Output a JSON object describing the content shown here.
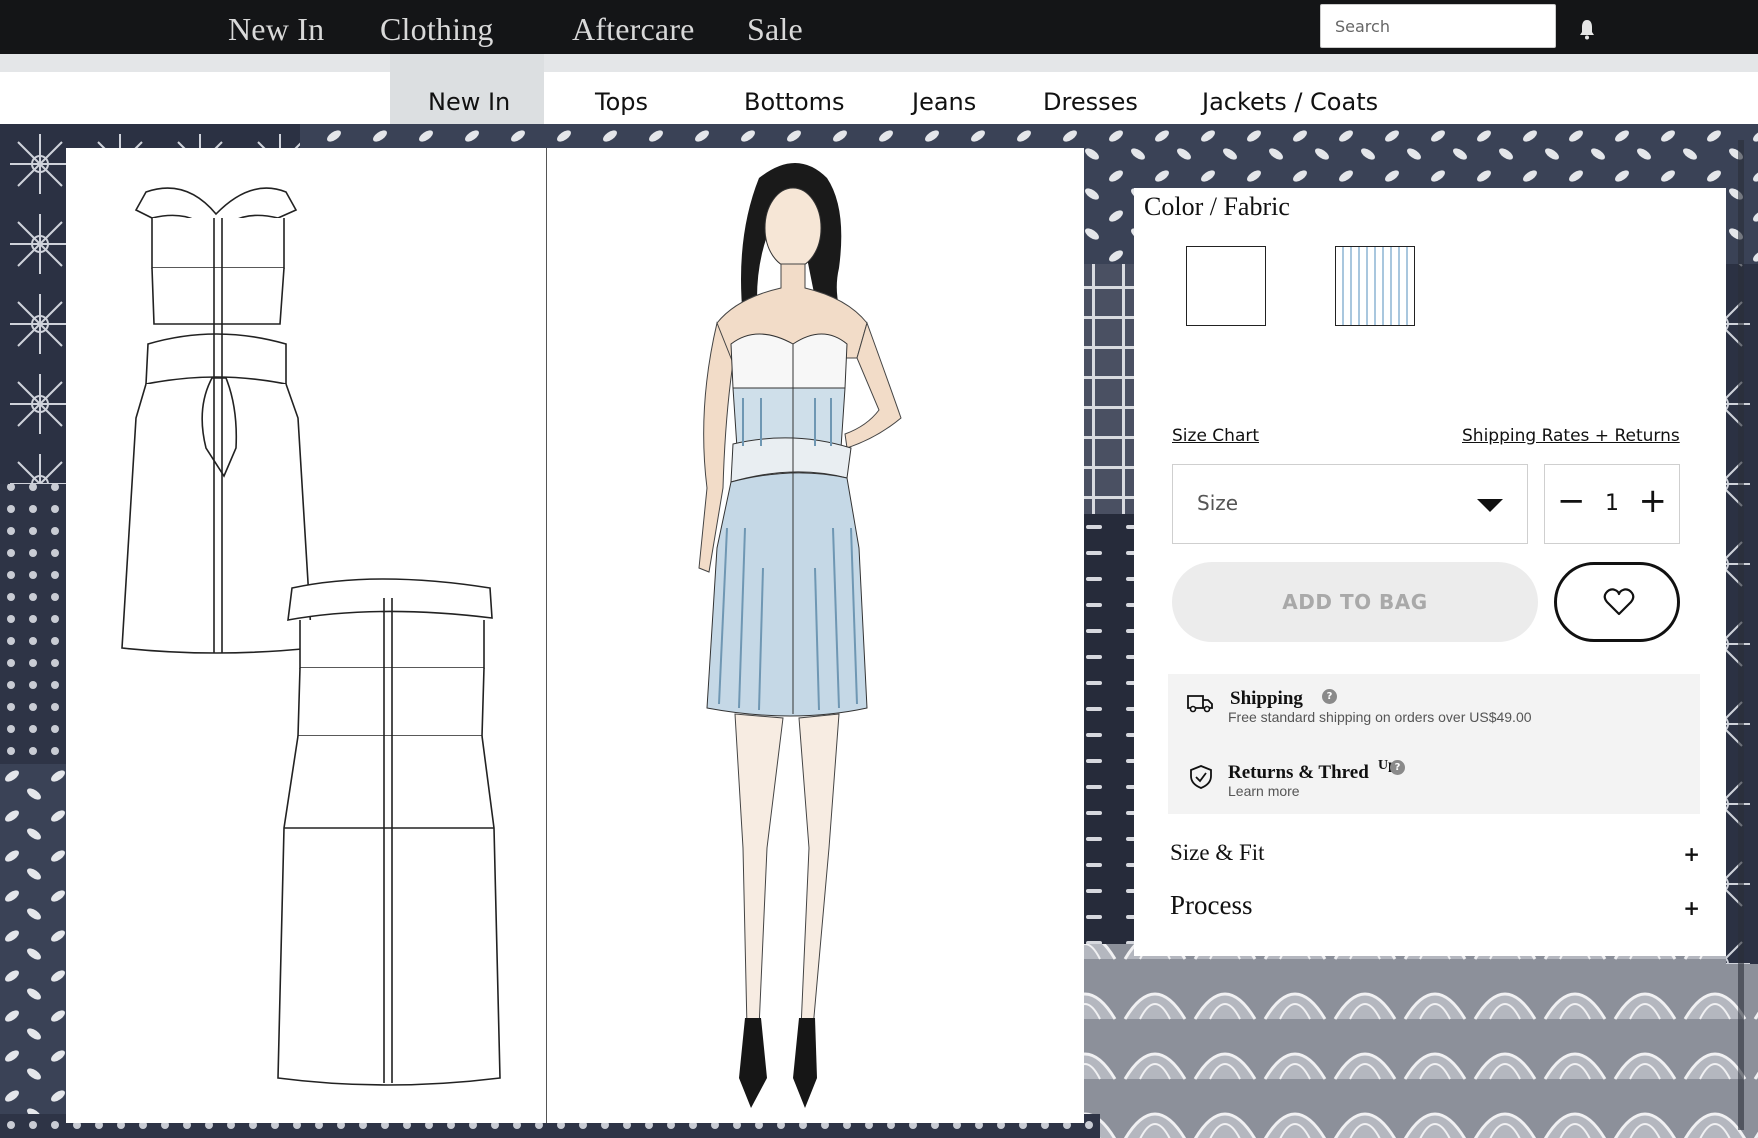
{
  "top_nav": {
    "items": [
      "New In",
      "Clothing",
      "Aftercare",
      "Sale"
    ],
    "search_placeholder": "Search",
    "bell_icon": "bell-icon"
  },
  "sub_nav": {
    "items": [
      "New In",
      "Tops",
      "Bottoms",
      "Jeans",
      "Dresses",
      "Jackets / Coats"
    ],
    "active": "New In"
  },
  "product": {
    "color_fabric_label": "Color / Fabric",
    "swatches": [
      {
        "name": "white-solid",
        "color": "#ffffff"
      },
      {
        "name": "blue-pinstripe",
        "color": "#a9c7de"
      }
    ],
    "size_chart_link": "Size Chart",
    "shipping_returns_link": "Shipping Rates + Returns",
    "size_placeholder": "Size",
    "quantity": "1",
    "minus": "−",
    "plus": "+",
    "add_to_bag": "ADD TO BAG",
    "shipping": {
      "title": "Shipping",
      "subtitle": "Free standard shipping on orders over US$49.00",
      "icon": "truck-icon",
      "help": "?"
    },
    "returns": {
      "title": "Returns & Thred",
      "superscript": "Up",
      "subtitle": "Learn more",
      "icon": "shield-check-icon",
      "help": "?"
    },
    "accordions": [
      {
        "label": "Size & Fit",
        "toggle": "+"
      },
      {
        "label": "Process",
        "toggle": "+"
      }
    ]
  },
  "colors": {
    "nav_bg": "#141517",
    "nav_text": "#d9d9d9",
    "sub_active_bg": "#dcdfe1",
    "button_disabled_bg": "#ececec",
    "button_disabled_text": "#a9a9a9",
    "pattern_base": "#2e3446"
  }
}
